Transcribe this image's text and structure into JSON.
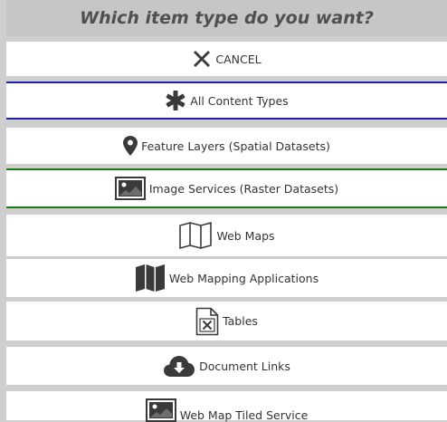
{
  "header": {
    "title": "Which item type do you want?"
  },
  "items": [
    {
      "label": "CANCEL",
      "icon": "close-icon"
    },
    {
      "label": "All Content Types",
      "icon": "asterisk-icon"
    },
    {
      "label": "Feature Layers (Spatial Datasets)",
      "icon": "map-marker-icon"
    },
    {
      "label": "Image Services (Raster Datasets)",
      "icon": "image-icon"
    },
    {
      "label": "Web Maps",
      "icon": "map-outline-icon"
    },
    {
      "label": "Web Mapping Applications",
      "icon": "map-filled-icon"
    },
    {
      "label": "Tables",
      "icon": "excel-file-icon"
    },
    {
      "label": "Document Links",
      "icon": "cloud-download-icon"
    },
    {
      "label": "Web Map Tiled Service",
      "icon": "image-icon"
    }
  ],
  "colors": {
    "header_bg": "#c6c6c6",
    "header_text": "#505050",
    "item_bg": "#ffffff",
    "separator": "#cfcfcf",
    "accent_blue": "#1f1fb4",
    "accent_green": "#1a7a1a",
    "icon": "#3a3a3a"
  }
}
